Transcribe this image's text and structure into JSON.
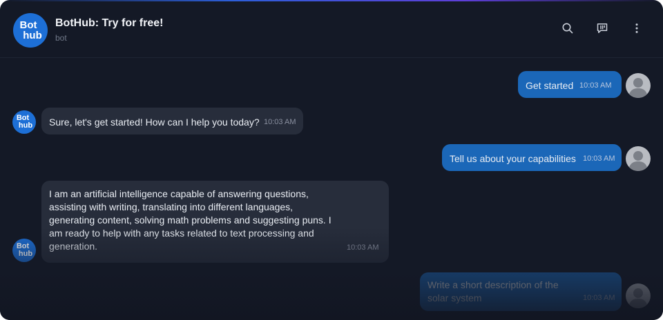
{
  "header": {
    "logo_line1": "Bot",
    "logo_line2": "hub",
    "title": "BotHub: Try for free!",
    "subtitle": "bot"
  },
  "toolbar": {
    "search_icon": "search-icon",
    "feedback_icon": "feedback-icon",
    "more_icon": "more-vertical-icon"
  },
  "messages": [
    {
      "sender": "user",
      "text": "Get started",
      "time": "10:03 AM"
    },
    {
      "sender": "bot",
      "text": "Sure, let's get started! How can I help you today?",
      "time": "10:03 AM"
    },
    {
      "sender": "user",
      "text": "Tell us about your capabilities",
      "time": "10:03 AM"
    },
    {
      "sender": "bot",
      "lines": [
        "I am an artificial intelligence capable of answering questions,",
        "assisting with writing, translating into different languages,",
        "generating content, solving math problems and suggesting puns. I",
        "am ready to help with any tasks related to text processing and",
        "generation."
      ],
      "time": "10:03 AM"
    },
    {
      "sender": "user",
      "lines": [
        "Write a short description of the",
        "solar system"
      ],
      "time": "10:03 AM"
    }
  ],
  "colors": {
    "background": "#141926",
    "user_bubble": "#1b67b8",
    "bot_bubble": "#272d3b",
    "brand": "#1d6fd6"
  }
}
